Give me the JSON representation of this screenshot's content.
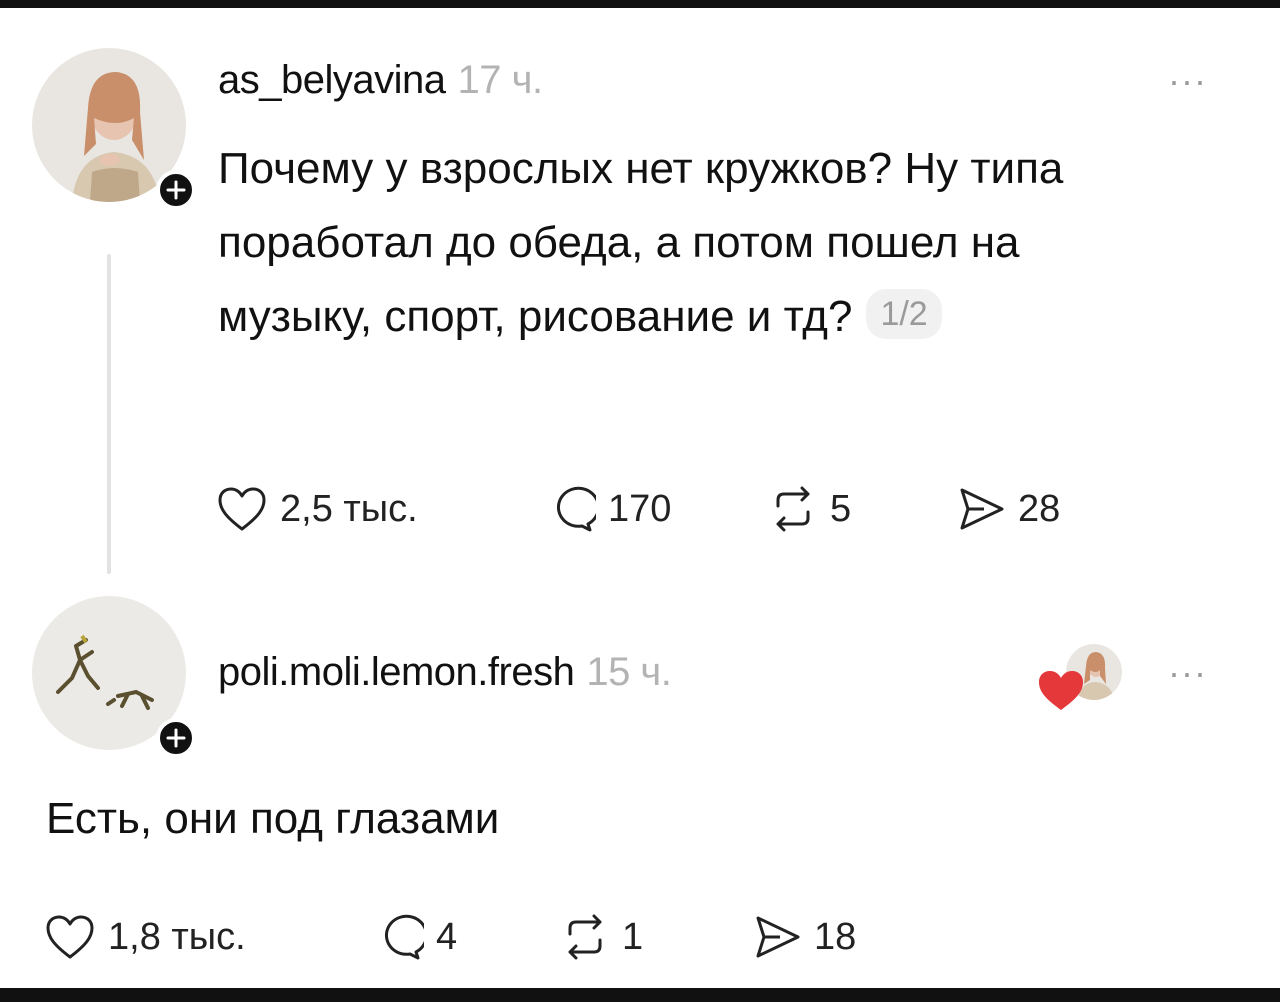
{
  "post": {
    "username": "as_belyavina",
    "time": "17 ч.",
    "more": "···",
    "text": "Почему у взрослых нет кружков? Ну типа поработал до обеда, а потом пошел на музыку, спорт, рисование и тд?",
    "page_indicator": "1/2",
    "likes": "2,5 тыс.",
    "comments": "170",
    "reposts": "5",
    "shares": "28"
  },
  "reply": {
    "username": "poli.moli.lemon.fresh",
    "time": "15 ч.",
    "more": "···",
    "text": "Есть, они под глазами",
    "likes": "1,8 тыс.",
    "comments": "4",
    "reposts": "1",
    "shares": "18"
  },
  "icons": {
    "like": "heart-outline-icon",
    "comment": "speech-bubble-icon",
    "repost": "repost-arrows-icon",
    "share": "send-arrow-icon",
    "follow": "plus-icon",
    "liked_by_author": "red-heart-icon"
  },
  "colors": {
    "text": "#111111",
    "muted": "#b3b3b3",
    "heart_red": "#e5383b"
  }
}
